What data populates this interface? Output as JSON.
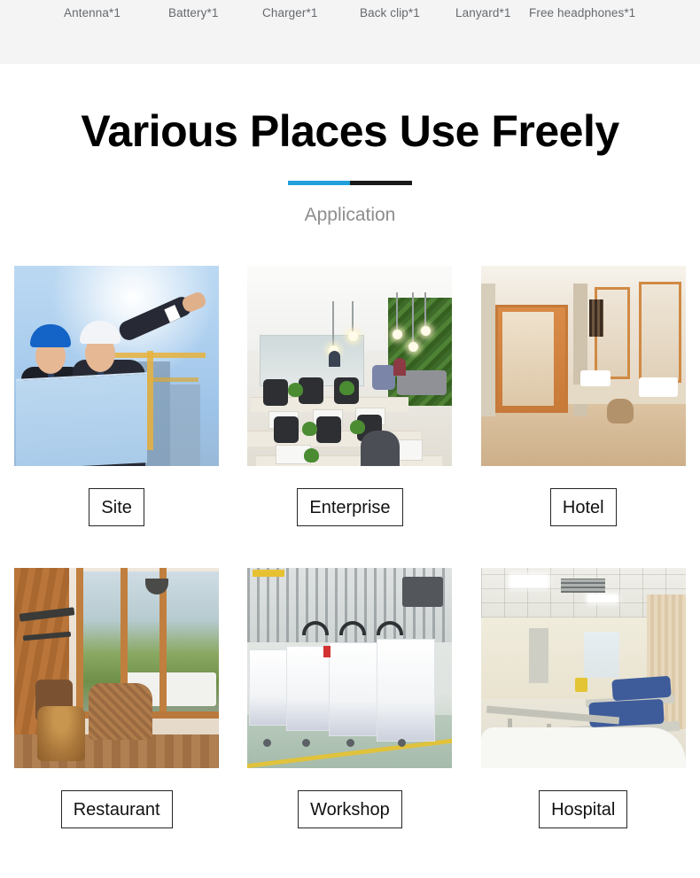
{
  "accessories": {
    "items": [
      "Antenna*1",
      "Battery*1",
      "Charger*1",
      "Back clip*1",
      "Lanyard*1",
      "Free headphones*1"
    ]
  },
  "heading": {
    "title": "Various Places Use Freely",
    "subtitle": "Application",
    "rule_color_primary": "#21a0da",
    "rule_color_secondary": "#1a1a1a"
  },
  "applications": {
    "rows": [
      [
        {
          "label": "Site",
          "photo": "construction-site-engineers-photo"
        },
        {
          "label": "Enterprise",
          "photo": "open-plan-office-photo"
        },
        {
          "label": "Hotel",
          "photo": "hotel-bathroom-corridor-photo"
        }
      ],
      [
        {
          "label": "Restaurant",
          "photo": "restaurant-terrace-photo"
        },
        {
          "label": "Workshop",
          "photo": "factory-workshop-machines-photo"
        },
        {
          "label": "Hospital",
          "photo": "hospital-ward-beds-photo"
        }
      ]
    ]
  }
}
